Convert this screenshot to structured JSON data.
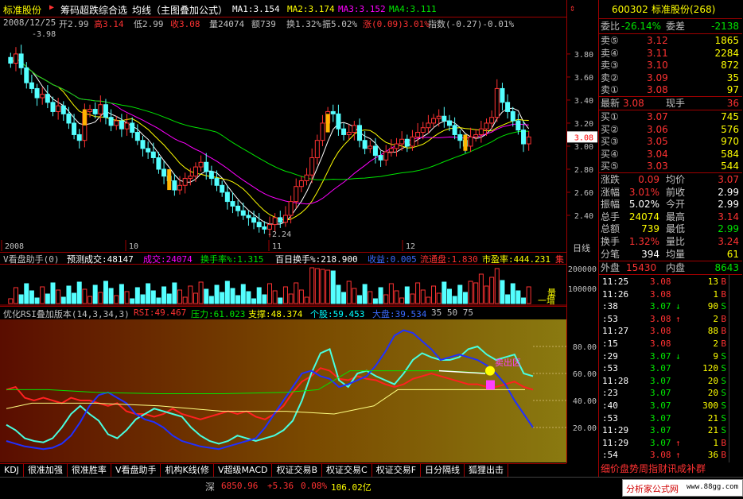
{
  "header": {
    "stock_name": "标准股份",
    "menu_label": "筹码超跌综合选",
    "indicator_name": "均线（主图叠加公式）",
    "ma1": "MA1:3.154",
    "ma2": "MA2:3.174",
    "ma3": "MA3:3.152",
    "ma4": "MA4:3.111",
    "date": "2008/12/25",
    "open": "开2.99",
    "high": "高3.14",
    "low": "低2.99",
    "close": "收3.08",
    "vol": "量24074",
    "amount": "额739",
    "turnover": "换1.32%",
    "amplitude": "振5.02%",
    "change": "涨(0.09)3.01%",
    "index": "指数(-0.27)-0.01%"
  },
  "main_axis": {
    "ticks": [
      "3.80",
      "3.60",
      "3.40",
      "3.20",
      "3.00",
      "2.80",
      "2.60",
      "2.40"
    ],
    "current_price": "3.08",
    "hi_label": "3.98",
    "lo_label": "2.24",
    "months": [
      "2008",
      "10",
      "11",
      "12"
    ],
    "period_label": "日线"
  },
  "volume_pane": {
    "title": "V看盘助手(0)",
    "f1": "预测成交:48147",
    "f2": "成交:24074",
    "f3": "换手率%:1.315",
    "f4": "百日换手%:218.900",
    "f5": "收益:0.005",
    "f6": "流通盘:1.830",
    "f7": "市盈率:444.231",
    "f8": "集",
    "tick_top": "200000",
    "tick_bottom": "100000",
    "side_label_1": "量",
    "side_label_2": "一增"
  },
  "rsi_pane": {
    "title": "优化RSI叠加版本(14,3,34,3)",
    "rsi": "RSI:49.467",
    "pressure": "压力:61.023",
    "support": "支撑:48.374",
    "stock": "个股:59.453",
    "market": "大盘:39.534",
    "levels": "35 50 75",
    "ticks": [
      "80.00",
      "60.00",
      "40.00",
      "20.00"
    ],
    "label_text": "卖出区"
  },
  "tabs": [
    "KDJ",
    "很准加强",
    "很准胜率",
    "V看盘助手",
    "机构K线(修",
    "V超级MACD",
    "权证交易B",
    "权证交易C",
    "权证交易F",
    "日分隔线",
    "狐狸出击"
  ],
  "status": {
    "market": "深",
    "index": "6850.96",
    "change": "+5.36",
    "pct": "0.08%",
    "amount": "106.02亿",
    "watermark": "分析家公式网",
    "watermark_url": "www.88gg.com"
  },
  "quote": {
    "code": "600302",
    "name": "标准股份(268)",
    "ratio_label": "委比",
    "ratio": "-26.14%",
    "diff_label": "委差",
    "diff": "-2138",
    "asks": [
      {
        "label": "卖⑤",
        "price": "3.12",
        "vol": "1865"
      },
      {
        "label": "卖④",
        "price": "3.11",
        "vol": "2284"
      },
      {
        "label": "卖③",
        "price": "3.10",
        "vol": "872"
      },
      {
        "label": "卖②",
        "price": "3.09",
        "vol": "35"
      },
      {
        "label": "卖①",
        "price": "3.08",
        "vol": "97"
      }
    ],
    "last_label": "最新",
    "last": "3.08",
    "hand_label": "现手",
    "hand": "36",
    "bids": [
      {
        "label": "买①",
        "price": "3.07",
        "vol": "745"
      },
      {
        "label": "买②",
        "price": "3.06",
        "vol": "576"
      },
      {
        "label": "买③",
        "price": "3.05",
        "vol": "970"
      },
      {
        "label": "买④",
        "price": "3.04",
        "vol": "584"
      },
      {
        "label": "买⑤",
        "price": "3.03",
        "vol": "544"
      }
    ],
    "stats": [
      {
        "k1": "涨跌",
        "v1": "0.09",
        "k2": "均价",
        "v2": "3.07"
      },
      {
        "k1": "涨幅",
        "v1": "3.01%",
        "k2": "前收",
        "v2": "2.99"
      },
      {
        "k1": "振幅",
        "v1": "5.02%",
        "k2": "今开",
        "v2": "2.99"
      },
      {
        "k1": "总手",
        "v1": "24074",
        "k2": "最高",
        "v2": "3.14"
      },
      {
        "k1": "总额",
        "v1": "739",
        "k2": "最低",
        "v2": "2.99"
      },
      {
        "k1": "换手",
        "v1": "1.32%",
        "k2": "量比",
        "v2": "3.24"
      },
      {
        "k1": "分笔",
        "v1": "394",
        "k2": "均量",
        "v2": "61"
      }
    ],
    "outer_label": "外盘",
    "outer": "15430",
    "inner_label": "内盘",
    "inner": "8643",
    "ticks": [
      {
        "t": "11:25",
        "p": "3.08",
        "a": "",
        "v": "13",
        "s": "B"
      },
      {
        "t": "11:26",
        "p": "3.08",
        "a": "",
        "v": "1",
        "s": "B"
      },
      {
        "t": ":38",
        "p": "3.07",
        "a": "↓",
        "v": "90",
        "s": "S"
      },
      {
        "t": ":53",
        "p": "3.08",
        "a": "↑",
        "v": "2",
        "s": "B"
      },
      {
        "t": "11:27",
        "p": "3.08",
        "a": "",
        "v": "88",
        "s": "B"
      },
      {
        "t": ":15",
        "p": "3.08",
        "a": "",
        "v": "2",
        "s": "B"
      },
      {
        "t": ":29",
        "p": "3.07",
        "a": "↓",
        "v": "9",
        "s": "S"
      },
      {
        "t": ":53",
        "p": "3.07",
        "a": "",
        "v": "120",
        "s": "S"
      },
      {
        "t": "11:28",
        "p": "3.07",
        "a": "",
        "v": "20",
        "s": "S"
      },
      {
        "t": ":23",
        "p": "3.07",
        "a": "",
        "v": "20",
        "s": "S"
      },
      {
        "t": ":40",
        "p": "3.07",
        "a": "",
        "v": "300",
        "s": "S"
      },
      {
        "t": ":53",
        "p": "3.07",
        "a": "",
        "v": "21",
        "s": "S"
      },
      {
        "t": "11:29",
        "p": "3.07",
        "a": "",
        "v": "21",
        "s": "S"
      },
      {
        "t": "11:29",
        "p": "3.07",
        "a": "↑",
        "v": "1",
        "s": "B"
      },
      {
        "t": ":54",
        "p": "3.08",
        "a": "↑",
        "v": "36",
        "s": "B"
      }
    ],
    "bottom_tabs": "细价盘势周指财讯成补群"
  }
}
